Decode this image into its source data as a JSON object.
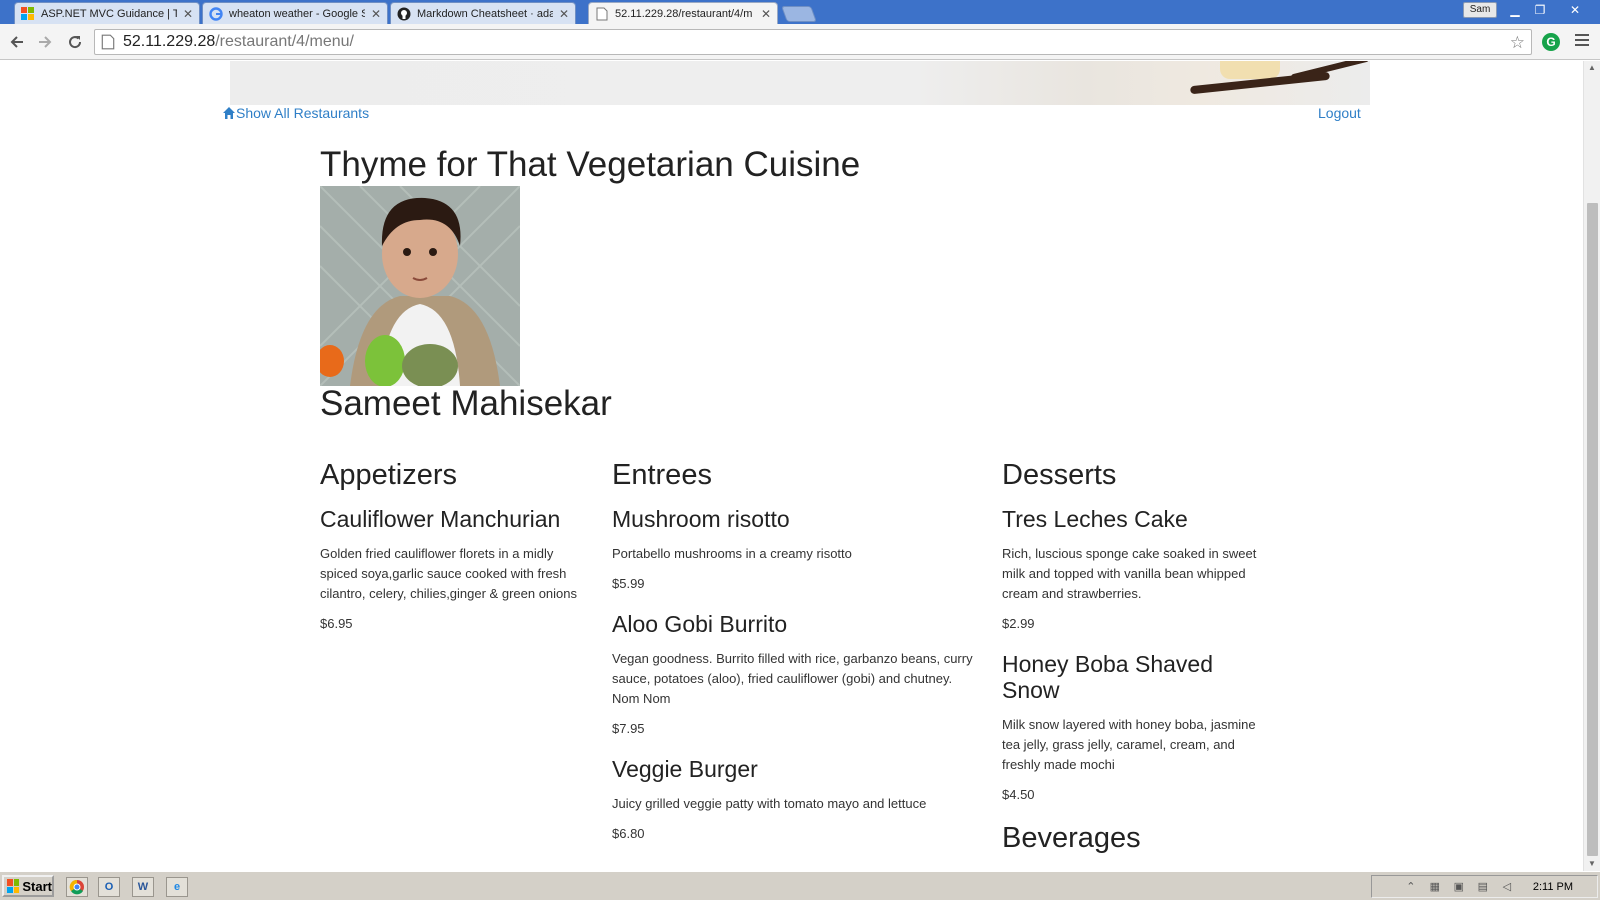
{
  "browser": {
    "tabs": [
      {
        "title": "ASP.NET MVC Guidance | The",
        "icon": "windows-logo-icon"
      },
      {
        "title": "wheaton weather - Google S",
        "icon": "google-icon"
      },
      {
        "title": "Markdown Cheatsheet · adam",
        "icon": "github-icon"
      },
      {
        "title": "52.11.229.28/restaurant/4/m",
        "icon": "page-icon",
        "active": true
      }
    ],
    "user_badge": "Sam",
    "url_host": "52.11.229.28",
    "url_path": "/restaurant/4/menu/",
    "extension_label": "G"
  },
  "page": {
    "nav": {
      "show_all": "Show All Restaurants",
      "logout": "Logout"
    },
    "restaurant_name": "Thyme for That Vegetarian Cuisine",
    "owner_name": "Sameet Mahisekar",
    "menu": {
      "appetizers": {
        "heading": "Appetizers",
        "items": [
          {
            "name": "Cauliflower Manchurian",
            "description": "Golden fried cauliflower florets in a midly spiced soya,garlic sauce cooked with fresh cilantro, celery, chilies,ginger & green onions",
            "price": "$6.95"
          }
        ]
      },
      "entrees": {
        "heading": "Entrees",
        "items": [
          {
            "name": "Mushroom risotto",
            "description": "Portabello mushrooms in a creamy risotto",
            "price": "$5.99"
          },
          {
            "name": "Aloo Gobi Burrito",
            "description": "Vegan goodness. Burrito filled with rice, garbanzo beans, curry sauce, potatoes (aloo), fried cauliflower (gobi) and chutney. Nom Nom",
            "price": "$7.95"
          },
          {
            "name": "Veggie Burger",
            "description": "Juicy grilled veggie patty with tomato mayo and lettuce",
            "price": "$6.80"
          }
        ]
      },
      "desserts": {
        "heading": "Desserts",
        "items": [
          {
            "name": "Tres Leches Cake",
            "description": "Rich, luscious sponge cake soaked in sweet milk and topped with vanilla bean whipped cream and strawberries.",
            "price": "$2.99"
          },
          {
            "name": "Honey Boba Shaved Snow",
            "description": "Milk snow layered with honey boba, jasmine tea jelly, grass jelly, caramel, cream, and freshly made mochi",
            "price": "$4.50"
          }
        ]
      },
      "beverages": {
        "heading": "Beverages"
      }
    }
  },
  "taskbar": {
    "start_label": "Start",
    "clock": "2:11 PM",
    "quick_launch_outlook": "O",
    "quick_launch_word": "W"
  },
  "colors": {
    "link": "#2f7fc7",
    "tabbar": "#3d72c9",
    "taskbar": "#d4d0c8"
  }
}
